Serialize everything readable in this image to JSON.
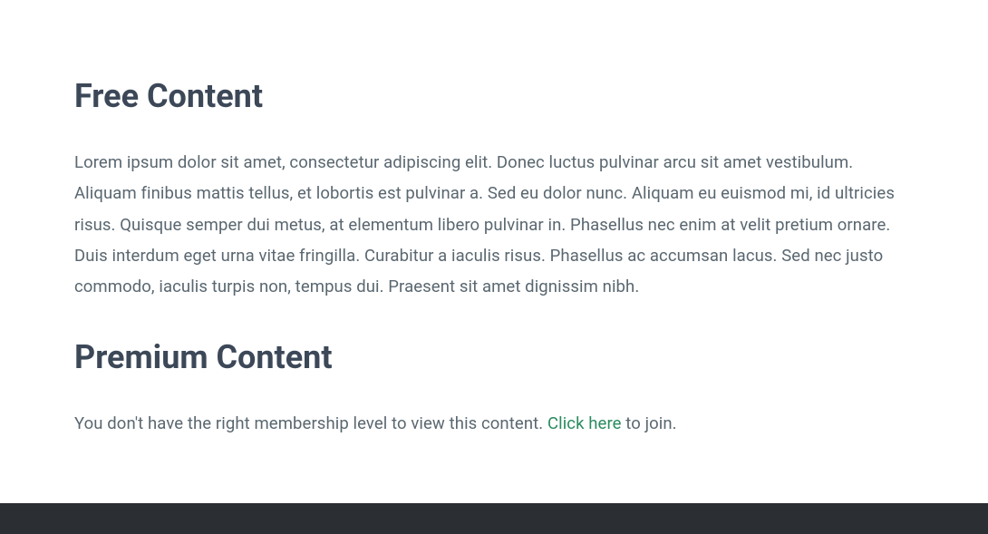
{
  "sections": {
    "free": {
      "heading": "Free Content",
      "body": "Lorem ipsum dolor sit amet, consectetur adipiscing elit. Donec luctus pulvinar arcu sit amet vestibulum. Aliquam finibus mattis tellus, et lobortis est pulvinar a. Sed eu dolor nunc. Aliquam eu euismod mi, id ultricies risus. Quisque semper dui metus, at elementum libero pulvinar in. Phasellus nec enim at velit pretium ornare. Duis interdum eget urna vitae fringilla. Curabitur a iaculis risus. Phasellus ac accumsan lacus. Sed nec justo commodo, iaculis turpis non, tempus dui. Praesent sit amet dignissim nibh."
    },
    "premium": {
      "heading": "Premium Content",
      "restriction_prefix": "You don't have the right membership level to view this content. ",
      "restriction_link_text": "Click here",
      "restriction_suffix": " to join."
    }
  }
}
